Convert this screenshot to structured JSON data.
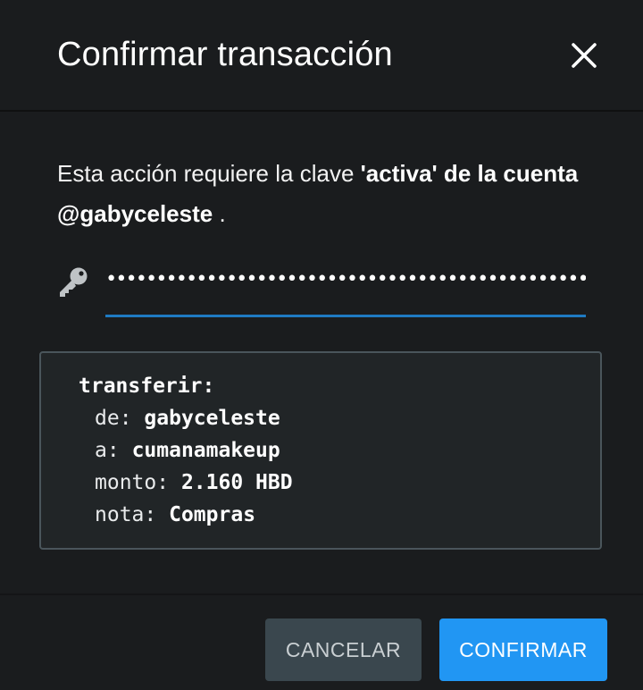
{
  "dialog": {
    "title": "Confirmar transacción",
    "close_icon": "close-icon"
  },
  "message": {
    "prefix": "Esta acción requiere la clave ",
    "key_role": "'activa' de la cuenta",
    "account": " @gabyceleste",
    "suffix": " ."
  },
  "password": {
    "icon": "key-icon",
    "value": "••••••••••••••••••••••••••••••••••••••••••••••••••••"
  },
  "operation": {
    "title": "transferir:",
    "fields": [
      {
        "key": "de:",
        "value": "gabyceleste"
      },
      {
        "key": "a:",
        "value": "cumanamakeup"
      },
      {
        "key": "monto:",
        "value": "2.160 HBD"
      },
      {
        "key": "nota:",
        "value": "Compras"
      }
    ]
  },
  "buttons": {
    "cancel": "CANCELAR",
    "confirm": "CONFIRMAR"
  },
  "colors": {
    "background": "#1a1c1e",
    "accent": "#2196f3",
    "underline": "#1f7ac2",
    "cancel_bg": "#3a474e",
    "box_border": "#4a555b"
  }
}
